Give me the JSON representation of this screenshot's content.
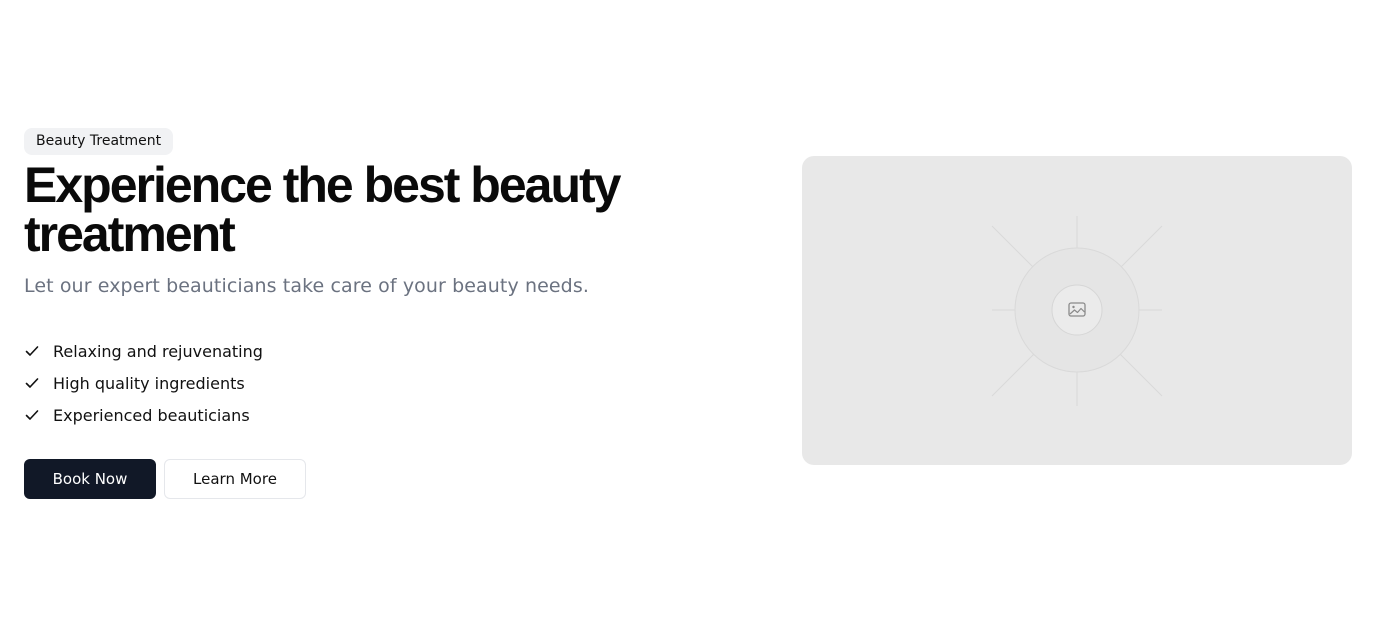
{
  "hero": {
    "badge": "Beauty Treatment",
    "title": "Experience the best beauty treatment",
    "subtitle": "Let our expert beauticians take care of your beauty needs.",
    "features": [
      {
        "icon": "check-icon",
        "label": "Relaxing and rejuvenating"
      },
      {
        "icon": "check-icon",
        "label": "High quality ingredients"
      },
      {
        "icon": "check-icon",
        "label": "Experienced beauticians"
      }
    ],
    "primary_button": "Book Now",
    "secondary_button": "Learn More",
    "image": {
      "icon": "image-icon",
      "background_color": "#e8e8e8"
    }
  },
  "colors": {
    "primary_button_bg": "#111827",
    "subtitle_text": "#6b7280",
    "badge_bg": "#f1f2f4"
  }
}
